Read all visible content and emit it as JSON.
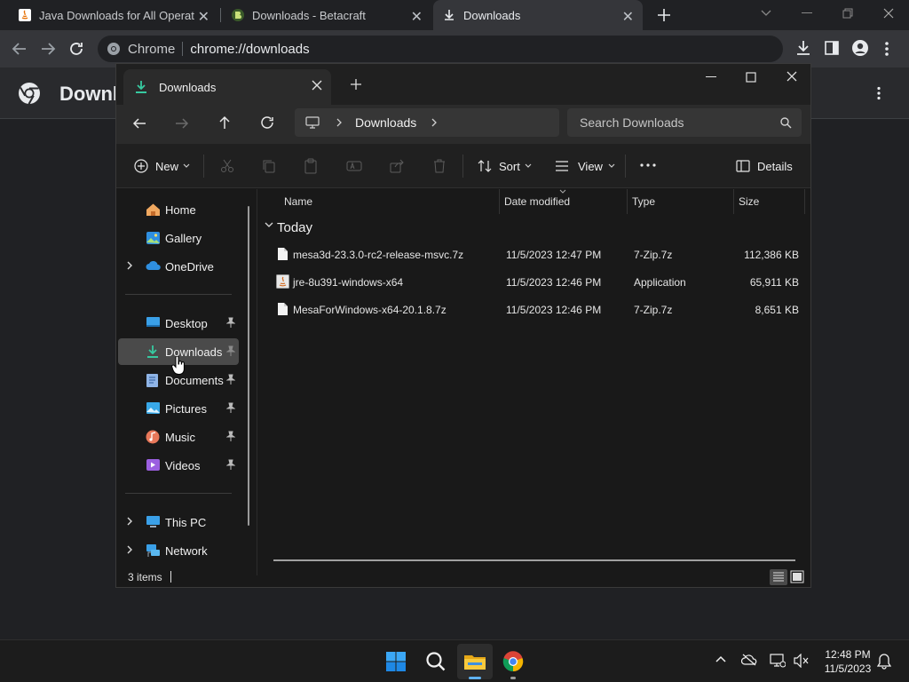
{
  "chrome": {
    "tabs": [
      {
        "title": "Java Downloads for All Operating Systems",
        "icon": "java-icon"
      },
      {
        "title": "Downloads - Betacraft",
        "icon": "betacraft-icon"
      },
      {
        "title": "Downloads",
        "icon": "download-icon"
      }
    ],
    "omnibox": {
      "scheme_label": "Chrome",
      "url": "chrome://downloads"
    },
    "page_title": "Downloads"
  },
  "explorer": {
    "tab_title": "Downloads",
    "breadcrumb": [
      "Downloads"
    ],
    "search_placeholder": "Search Downloads",
    "commands": {
      "new": "New",
      "sort": "Sort",
      "view": "View",
      "details": "Details"
    },
    "nav": {
      "top": [
        "Home",
        "Gallery",
        "OneDrive"
      ],
      "quick": [
        "Desktop",
        "Downloads",
        "Documents",
        "Pictures",
        "Music",
        "Videos"
      ],
      "bottom": [
        "This PC",
        "Network"
      ],
      "selected": "Downloads"
    },
    "columns": [
      "Name",
      "Date modified",
      "Type",
      "Size"
    ],
    "group_label": "Today",
    "files": [
      {
        "name": "mesa3d-23.3.0-rc2-release-msvc.7z",
        "date": "11/5/2023 12:47 PM",
        "type": "7-Zip.7z",
        "size": "112,386 KB"
      },
      {
        "name": "jre-8u391-windows-x64",
        "date": "11/5/2023 12:46 PM",
        "type": "Application",
        "size": "65,911 KB"
      },
      {
        "name": "MesaForWindows-x64-20.1.8.7z",
        "date": "11/5/2023 12:46 PM",
        "type": "7-Zip.7z",
        "size": "8,651 KB"
      }
    ],
    "status": "3 items"
  },
  "taskbar": {
    "time": "12:48 PM",
    "date": "11/5/2023"
  },
  "colors": {
    "accent": "#0078d4",
    "folder": "#f4c542",
    "chrome_bg": "#202124"
  }
}
